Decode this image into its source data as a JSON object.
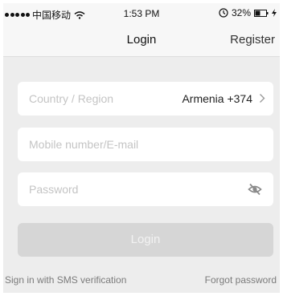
{
  "status_bar": {
    "carrier": "中国移动",
    "time": "1:53 PM",
    "battery": "32%"
  },
  "nav": {
    "title": "Login",
    "register_label": "Register"
  },
  "form": {
    "country_label": "Country / Region",
    "country_value": "Armenia +374",
    "mobile_placeholder": "Mobile number/E-mail",
    "password_placeholder": "Password",
    "login_label": "Login"
  },
  "links": {
    "sms_login": "Sign in with SMS verification",
    "forgot_password": "Forgot password"
  },
  "icons": [
    "wifi-icon",
    "lock-icon",
    "battery-icon",
    "charge-icon",
    "chevron-right-icon",
    "eye-slash-icon"
  ]
}
